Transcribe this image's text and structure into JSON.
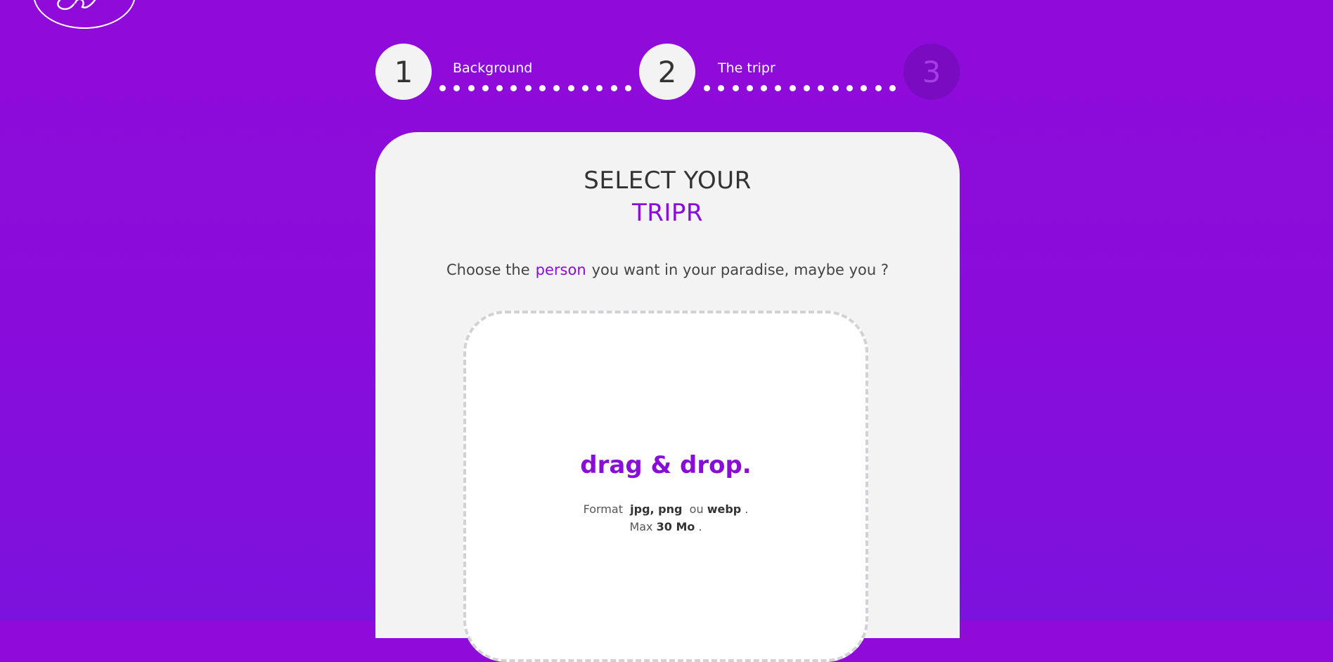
{
  "logo": {
    "icon": "script-logo-icon"
  },
  "stepper": {
    "steps": [
      {
        "number": "1",
        "label": "Background",
        "state": "done"
      },
      {
        "number": "2",
        "label": "The tripr",
        "state": "done"
      },
      {
        "number": "3",
        "label": "",
        "state": "current"
      }
    ]
  },
  "card": {
    "title_line1": "SELECT YOUR",
    "title_line2": "TRIPR",
    "subtitle_before": "Choose the",
    "subtitle_accent": "person",
    "subtitle_after": "you want in your paradise, maybe you ?"
  },
  "dropzone": {
    "title": "drag & drop.",
    "format_prefix": "Format",
    "format_types": "jpg, png",
    "format_or": "ou",
    "format_last": "webp",
    "format_suffix": ".",
    "max_prefix": "Max",
    "max_value": "30 Mo",
    "max_suffix": "."
  },
  "colors": {
    "accent": "#8a0cdb",
    "background": "#8f0bd9",
    "card": "#f3f3f3",
    "text": "#333333"
  }
}
